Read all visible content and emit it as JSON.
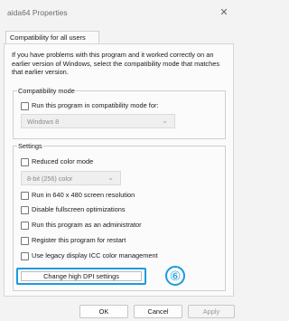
{
  "window": {
    "title": "aida64 Properties",
    "close_icon": "close-icon"
  },
  "tab": {
    "label": "Compatibility for all users"
  },
  "description": "If you have problems with this program and it worked correctly on an earlier version of Windows, select the compatibility mode that matches that earlier version.",
  "compat": {
    "legend": "Compatibility mode",
    "checkbox_label": "Run this program in compatibility mode for:",
    "select_value": "Windows 8"
  },
  "settings": {
    "legend": "Settings",
    "reduced_color": "Reduced color mode",
    "color_select_value": "8-bit (256) color",
    "run_640": "Run in 640 x 480 screen resolution",
    "disable_fullscreen": "Disable fullscreen optimizations",
    "run_admin": "Run this program as an administrator",
    "register_restart": "Register this program for restart",
    "legacy_icc": "Use legacy display ICC color management",
    "dpi_button": "Change high DPI settings"
  },
  "annotation": {
    "step": "⑥",
    "accent_color": "#1a9be0"
  },
  "footer": {
    "ok": "OK",
    "cancel": "Cancel",
    "apply": "Apply"
  }
}
